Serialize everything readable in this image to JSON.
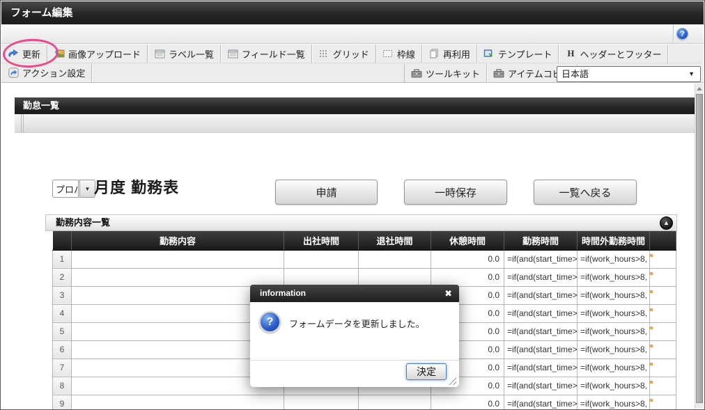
{
  "window": {
    "title": "フォーム編集"
  },
  "help": {
    "glyph": "?"
  },
  "colors": {
    "annotation_pink": "#e94a8b",
    "dark_bar": "#262626",
    "icon_blue": "#3e6fc8",
    "tick_orange": "#f0a050"
  },
  "toolbar": {
    "row1": [
      {
        "icon": "update-icon",
        "label": "更新"
      },
      {
        "icon": "image-upload-icon",
        "label": "画像アップロード"
      },
      {
        "icon": "label-list-icon",
        "label": "ラベル一覧"
      },
      {
        "icon": "field-list-icon",
        "label": "フィールド一覧"
      },
      {
        "icon": "grid-icon",
        "label": "グリッド"
      },
      {
        "icon": "border-icon",
        "label": "枠線"
      },
      {
        "icon": "reuse-icon",
        "label": "再利用"
      },
      {
        "icon": "template-icon",
        "label": "テンプレート"
      },
      {
        "icon": "header-footer-icon",
        "icon_text": "H",
        "label": "ヘッダーとフッター"
      }
    ],
    "row2_left": [
      {
        "icon": "action-settings-icon",
        "label": "アクション設定"
      }
    ],
    "row2_right": [
      {
        "icon": "toolkit-icon",
        "label": "ツールキット"
      },
      {
        "icon": "item-copy-icon",
        "label": "アイテムコピー"
      }
    ],
    "language_select": {
      "value": "日本語",
      "arrow": "▼"
    }
  },
  "form_header": {
    "title": "勤怠一覧"
  },
  "form": {
    "month_select_value": "プロパ",
    "month_select_arrow": "▼",
    "heading": "月度 勤務表",
    "buttons": {
      "apply": "申請",
      "temp_save": "一時保存",
      "back_to_list": "一覧へ戻る"
    }
  },
  "panel": {
    "title": "勤務内容一覧",
    "collapse_glyph": "▲"
  },
  "table": {
    "headers": [
      "",
      "勤務内容",
      "出社時間",
      "退社時間",
      "休憩時間",
      "勤務時間",
      "時間外勤務時間",
      ""
    ],
    "rows": [
      {
        "num": "1",
        "break_time": "0.0",
        "work_time": "=if(and(start_time>",
        "overtime": "=if(work_hours>8,"
      },
      {
        "num": "2",
        "break_time": "0.0",
        "work_time": "=if(and(start_time>",
        "overtime": "=if(work_hours>8,"
      },
      {
        "num": "3",
        "break_time": "0.0",
        "work_time": "=if(and(start_time>",
        "overtime": "=if(work_hours>8,"
      },
      {
        "num": "4",
        "break_time": "0.0",
        "work_time": "=if(and(start_time>",
        "overtime": "=if(work_hours>8,"
      },
      {
        "num": "5",
        "break_time": "0.0",
        "work_time": "=if(and(start_time>",
        "overtime": "=if(work_hours>8,"
      },
      {
        "num": "6",
        "break_time": "0.0",
        "work_time": "=if(and(start_time>",
        "overtime": "=if(work_hours>8,"
      },
      {
        "num": "7",
        "break_time": "0.0",
        "work_time": "=if(and(start_time>",
        "overtime": "=if(work_hours>8,"
      },
      {
        "num": "8",
        "break_time": "0.0",
        "work_time": "=if(and(start_time>",
        "overtime": "=if(work_hours>8,"
      },
      {
        "num": "9",
        "break_time": "0.0",
        "work_time": "=if(and(start_time>",
        "overtime": "=if(work_hours>8,"
      }
    ]
  },
  "dialog": {
    "title": "information",
    "close_glyph": "✖",
    "icon_glyph": "?",
    "message": "フォームデータを更新しました。",
    "ok": "決定"
  }
}
